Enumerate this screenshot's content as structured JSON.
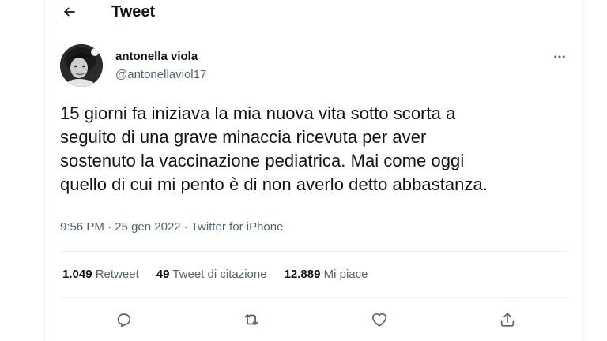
{
  "header": {
    "title": "Tweet",
    "back_icon": "arrow-left-icon"
  },
  "author": {
    "display_name": "antonella viola",
    "handle": "@antonellaviol17"
  },
  "tweet": {
    "lines": [
      "15 giorni fa iniziava la mia nuova vita sotto scorta a",
      "seguito di una grave minaccia ricevuta per aver",
      "sostenuto la vaccinazione pediatrica. Mai come oggi",
      "quello di cui mi pento è di non averlo detto abbastanza."
    ],
    "time": "9:56 PM",
    "separator": "·",
    "date": "25 gen 2022",
    "source": "Twitter for iPhone"
  },
  "stats": {
    "retweets_count": "1.049",
    "retweets_label": "Retweet",
    "quotes_count": "49",
    "quotes_label": "Tweet di citazione",
    "likes_count": "12.889",
    "likes_label": "Mi piace"
  },
  "actions": [
    "reply-icon",
    "retweet-icon",
    "like-icon",
    "share-icon"
  ],
  "colors": {
    "text": "#0f1419",
    "secondary": "#536471",
    "border": "#eff3f4"
  }
}
